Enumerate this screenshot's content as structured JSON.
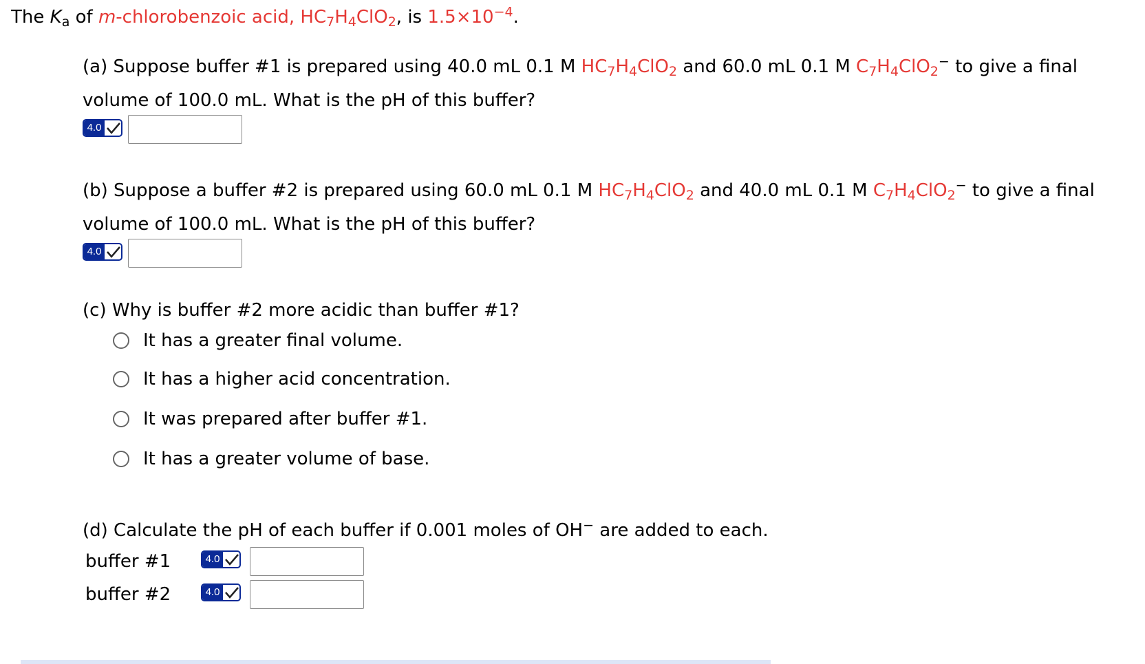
{
  "intro": {
    "the": "The",
    "k": "K",
    "k_sub": "a",
    "of": "of",
    "acid_name_prefix": "m",
    "acid_name_rest": "-chlorobenzoic acid,",
    "formula": {
      "p1": "HC",
      "s1": "7",
      "p2": "H",
      "s2": "4",
      "p3": "ClO",
      "s3": "2"
    },
    "is": ", is",
    "value": "1.5×10",
    "exponent": "−4",
    "end": "."
  },
  "acid": {
    "p1": "HC",
    "s1": "7",
    "p2": "H",
    "s2": "4",
    "p3": "ClO",
    "s3": "2"
  },
  "base": {
    "p1": "C",
    "s1": "7",
    "p2": "H",
    "s2": "4",
    "p3": "ClO",
    "s3": "2",
    "sup": "−"
  },
  "part_a": {
    "prefix": "(a) Suppose buffer #1 is prepared using 40.0 mL 0.1 M",
    "mid": "and 60.0 mL 0.1 M",
    "suffix": "to give a final volume of 100.0 mL. What is the pH of this buffer?",
    "answer": ""
  },
  "part_b": {
    "prefix": "(b) Suppose a buffer #2 is prepared using 60.0 mL 0.1 M",
    "mid": "and 40.0 mL 0.1 M",
    "suffix": "to give a final volume of 100.0 mL. What is the pH of this buffer?",
    "answer": ""
  },
  "part_c": {
    "question": "(c) Why is buffer #2 more acidic than buffer #1?",
    "options": [
      "It has a greater final volume.",
      "It has a higher acid concentration.",
      "It was prepared after buffer #1.",
      "It has a greater volume of base."
    ]
  },
  "part_d": {
    "question": "(d) Calculate the pH of each buffer if 0.001 moles of OH",
    "sup": "−",
    "question_end": "are added to each.",
    "buffer1_label": "buffer #1",
    "buffer2_label": "buffer #2",
    "buffer1_answer": "",
    "buffer2_answer": ""
  },
  "badge": {
    "version": "4.0",
    "icon": "check-icon"
  },
  "colors": {
    "highlight": "#e53935",
    "badge": "#0b2a97"
  }
}
